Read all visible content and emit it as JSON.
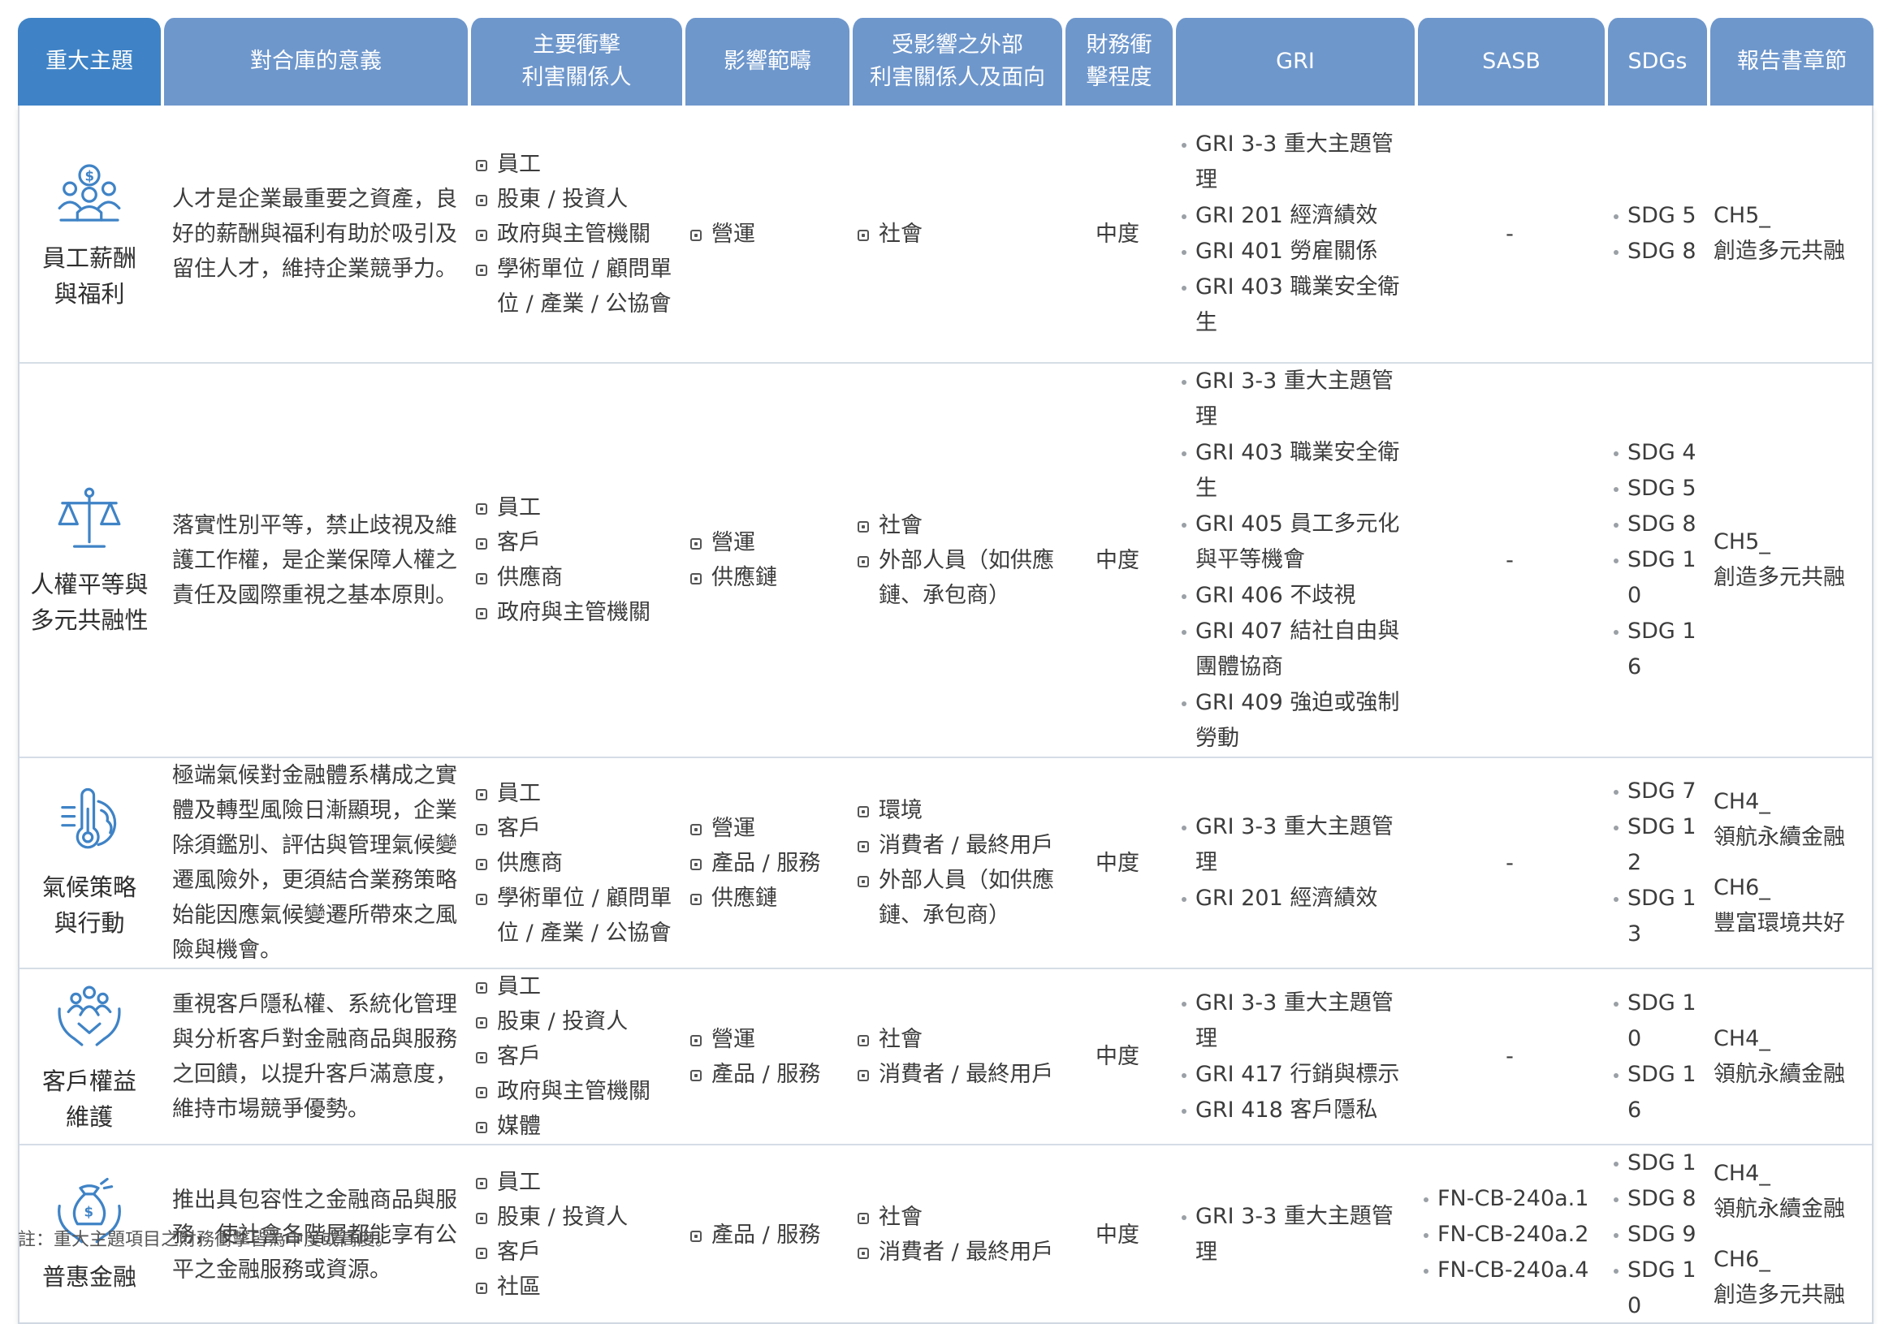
{
  "headers": {
    "topic": "重大主題",
    "meaning": "對合庫的意義",
    "stakeholders": [
      "主要衝擊",
      "利害關係人"
    ],
    "scope": "影響範疇",
    "external": [
      "受影響之外部",
      "利害關係人及面向"
    ],
    "financial": [
      "財務衝",
      "擊程度"
    ],
    "gri": "GRI",
    "sasb": "SASB",
    "sdgs": "SDGs",
    "chapter": "報告書章節"
  },
  "rows": [
    {
      "icon": "employee-compensation-icon",
      "topic": [
        "員工薪酬",
        "與福利"
      ],
      "meaning": "人才是企業最重要之資產，良好的薪酬與福利有助於吸引及留住人才，維持企業競爭力。",
      "stakeholders": [
        "員工",
        "股東 / 投資人",
        "政府與主管機關",
        "學術單位 / 顧問單位 / 產業 / 公協會"
      ],
      "scope": [
        "營運"
      ],
      "external": [
        "社會"
      ],
      "financial": "中度",
      "gri": [
        "GRI 3-3 重大主題管理",
        "GRI 201 經濟績效",
        "GRI 401 勞雇關係",
        "GRI 403 職業安全衛生"
      ],
      "sasb": [],
      "sasb_empty": "-",
      "sdgs": [
        "SDG 5",
        "SDG 8"
      ],
      "chapters": [
        [
          "CH5_",
          "創造多元共融"
        ]
      ]
    },
    {
      "icon": "scales-icon",
      "topic": [
        "人權平等與",
        "多元共融性"
      ],
      "meaning": "落實性別平等，禁止歧視及維護工作權，是企業保障人權之責任及國際重視之基本原則。",
      "stakeholders": [
        "員工",
        "客戶",
        "供應商",
        "政府與主管機關"
      ],
      "scope": [
        "營運",
        "供應鏈"
      ],
      "external": [
        "社會",
        "外部人員（如供應鏈、承包商）"
      ],
      "financial": "中度",
      "gri": [
        "GRI 3-3 重大主題管理",
        "GRI 403 職業安全衛生",
        "GRI 405 員工多元化與平等機會",
        "GRI 406 不歧視",
        "GRI 407 結社自由與團體協商",
        "GRI 409 強迫或強制勞動"
      ],
      "sasb": [],
      "sasb_empty": "-",
      "sdgs": [
        "SDG 4",
        "SDG 5",
        "SDG 8",
        "SDG 10",
        "SDG 16"
      ],
      "chapters": [
        [
          "CH5_",
          "創造多元共融"
        ]
      ]
    },
    {
      "icon": "climate-thermometer-icon",
      "topic": [
        "氣候策略",
        "與行動"
      ],
      "meaning": "極端氣候對金融體系構成之實體及轉型風險日漸顯現，企業除須鑑別、評估與管理氣候變遷風險外，更須結合業務策略始能因應氣候變遷所帶來之風險與機會。",
      "stakeholders": [
        "員工",
        "客戶",
        "供應商",
        "學術單位 / 顧問單位 / 產業 / 公協會"
      ],
      "scope": [
        "營運",
        "產品 / 服務",
        "供應鏈"
      ],
      "external": [
        "環境",
        "消費者 / 最終用戶",
        "外部人員（如供應鏈、承包商）"
      ],
      "financial": "中度",
      "gri": [
        "GRI 3-3 重大主題管理",
        "GRI 201 經濟績效"
      ],
      "sasb": [],
      "sasb_empty": "-",
      "sdgs": [
        "SDG 7",
        "SDG 12",
        "SDG 13"
      ],
      "chapters": [
        [
          "CH4_",
          "領航永續金融"
        ],
        [
          "CH6_",
          "豐富環境共好"
        ]
      ]
    },
    {
      "icon": "customer-care-icon",
      "topic": [
        "客戶權益",
        "維護"
      ],
      "meaning": "重視客戶隱私權、系統化管理與分析客戶對金融商品與服務之回饋，以提升客戶滿意度，維持市場競爭優勢。",
      "stakeholders": [
        "員工",
        "股東 / 投資人",
        "客戶",
        "政府與主管機關",
        "媒體"
      ],
      "scope": [
        "營運",
        "產品 / 服務"
      ],
      "external": [
        "社會",
        "消費者 / 最終用戶"
      ],
      "financial": "中度",
      "gri": [
        "GRI 3-3 重大主題管理",
        "GRI 417 行銷與標示",
        "GRI 418 客戶隱私"
      ],
      "sasb": [],
      "sasb_empty": "-",
      "sdgs": [
        "SDG 10",
        "SDG 16"
      ],
      "chapters": [
        [
          "CH4_",
          "領航永續金融"
        ]
      ]
    },
    {
      "icon": "inclusive-finance-icon",
      "topic": [
        "普惠金融"
      ],
      "meaning": "推出具包容性之金融商品與服務，使社會各階層都能享有公平之金融服務或資源。",
      "stakeholders": [
        "員工",
        "股東 / 投資人",
        "客戶",
        "社區"
      ],
      "scope": [
        "產品 / 服務"
      ],
      "external": [
        "社會",
        "消費者 / 最終用戶"
      ],
      "financial": "中度",
      "gri": [
        "GRI 3-3 重大主題管理"
      ],
      "sasb": [
        "FN-CB-240a.1",
        "FN-CB-240a.2",
        "FN-CB-240a.4"
      ],
      "sasb_empty": "",
      "sdgs": [
        "SDG 1",
        "SDG 8",
        "SDG 9",
        "SDG 10"
      ],
      "chapters": [
        [
          "CH4_",
          "領航永續金融"
        ],
        [
          "CH6_",
          "創造多元共融"
        ]
      ]
    }
  ],
  "note": "註：重大主題項目之財務衝擊皆為中度或高度。",
  "colors": {
    "header": "#6e97cc",
    "header_first": "#3f83c6",
    "icon": "#3f83c6",
    "divider": "#d5dde6"
  }
}
